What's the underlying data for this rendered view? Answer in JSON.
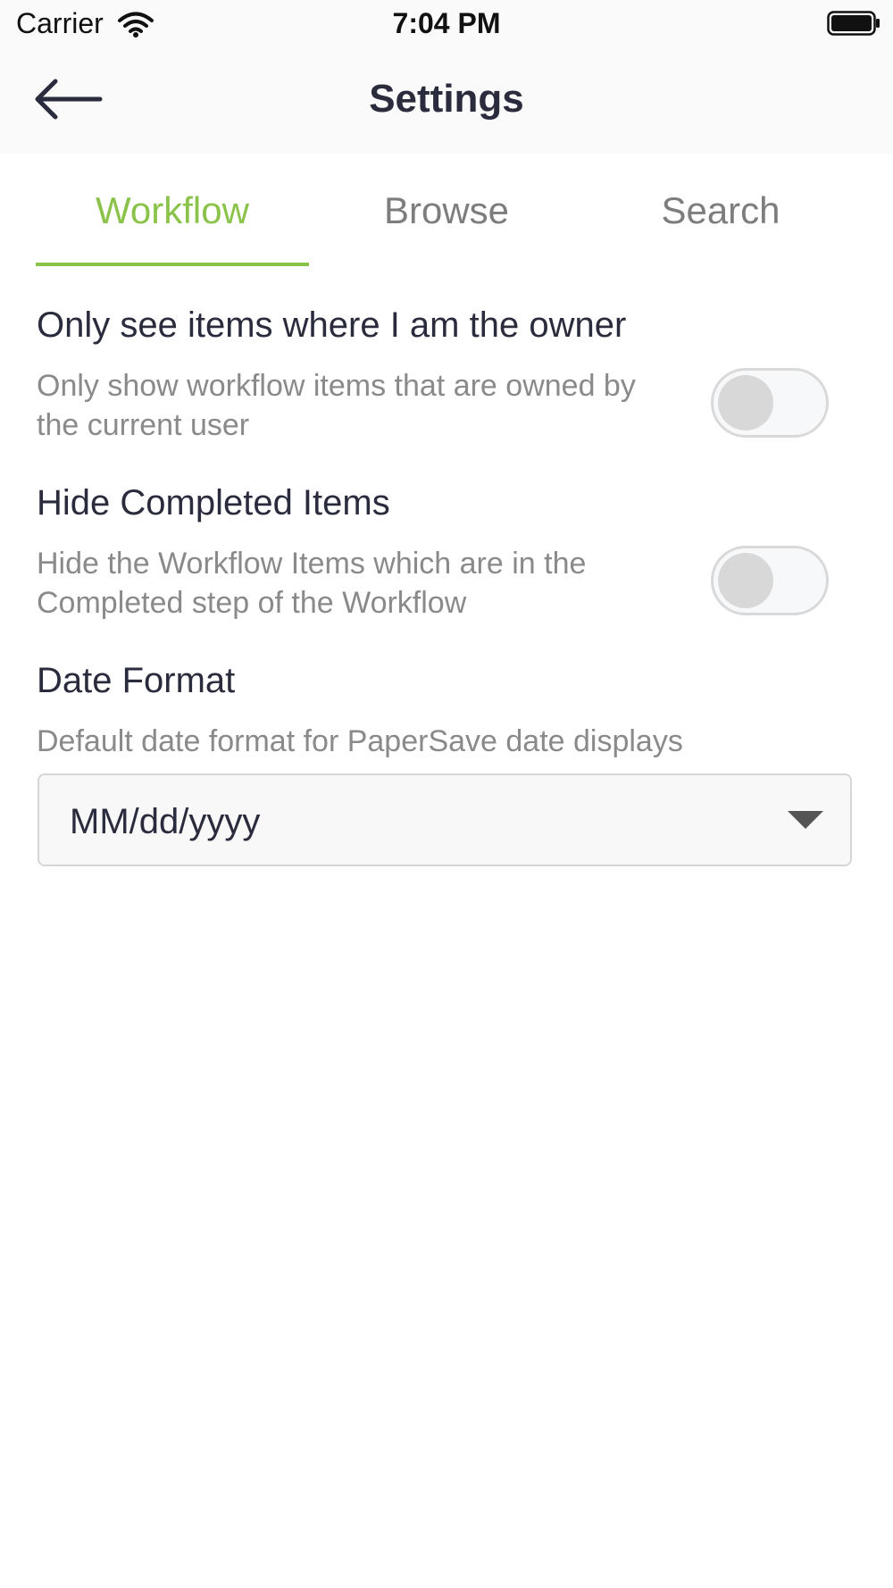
{
  "status_bar": {
    "carrier": "Carrier",
    "time": "7:04 PM",
    "wifi_icon": "wifi-icon",
    "battery_icon": "battery-icon"
  },
  "header": {
    "title": "Settings",
    "back_icon": "arrow-left-icon"
  },
  "tabs": [
    {
      "label": "Workflow",
      "active": true
    },
    {
      "label": "Browse",
      "active": false
    },
    {
      "label": "Search",
      "active": false
    }
  ],
  "settings": {
    "owner_only": {
      "title": "Only see items where I am the owner",
      "description": "Only show workflow items that are owned by the current user",
      "enabled": false
    },
    "hide_completed": {
      "title": "Hide Completed Items",
      "description": "Hide the Workflow Items which are in the Completed step of the Workflow",
      "enabled": false
    },
    "date_format": {
      "title": "Date Format",
      "description": "Default date format for PaperSave date displays",
      "value": "MM/dd/yyyy"
    }
  },
  "colors": {
    "accent": "#8bc34a",
    "text_primary": "#2a2c3e",
    "text_secondary": "#8a8a8a",
    "tab_inactive": "#7d7d7d"
  }
}
